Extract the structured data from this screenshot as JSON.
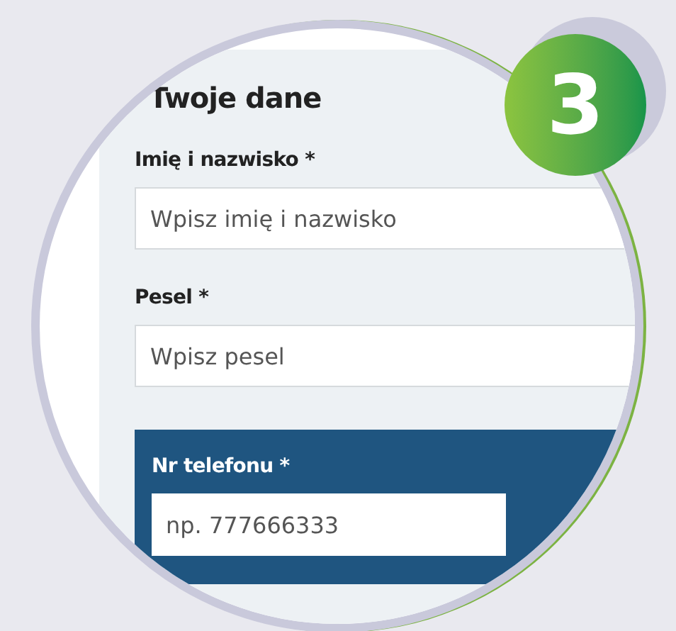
{
  "heading": "Twoje dane",
  "fields": [
    {
      "label": "Imię i nazwisko *",
      "placeholder": "Wpisz imię i nazwisko"
    },
    {
      "label": "Pesel *",
      "placeholder": "Wpisz pesel"
    }
  ],
  "phone_field": {
    "label": "Nr telefonu *",
    "placeholder": "np. 777666333"
  },
  "step_badge": "3"
}
